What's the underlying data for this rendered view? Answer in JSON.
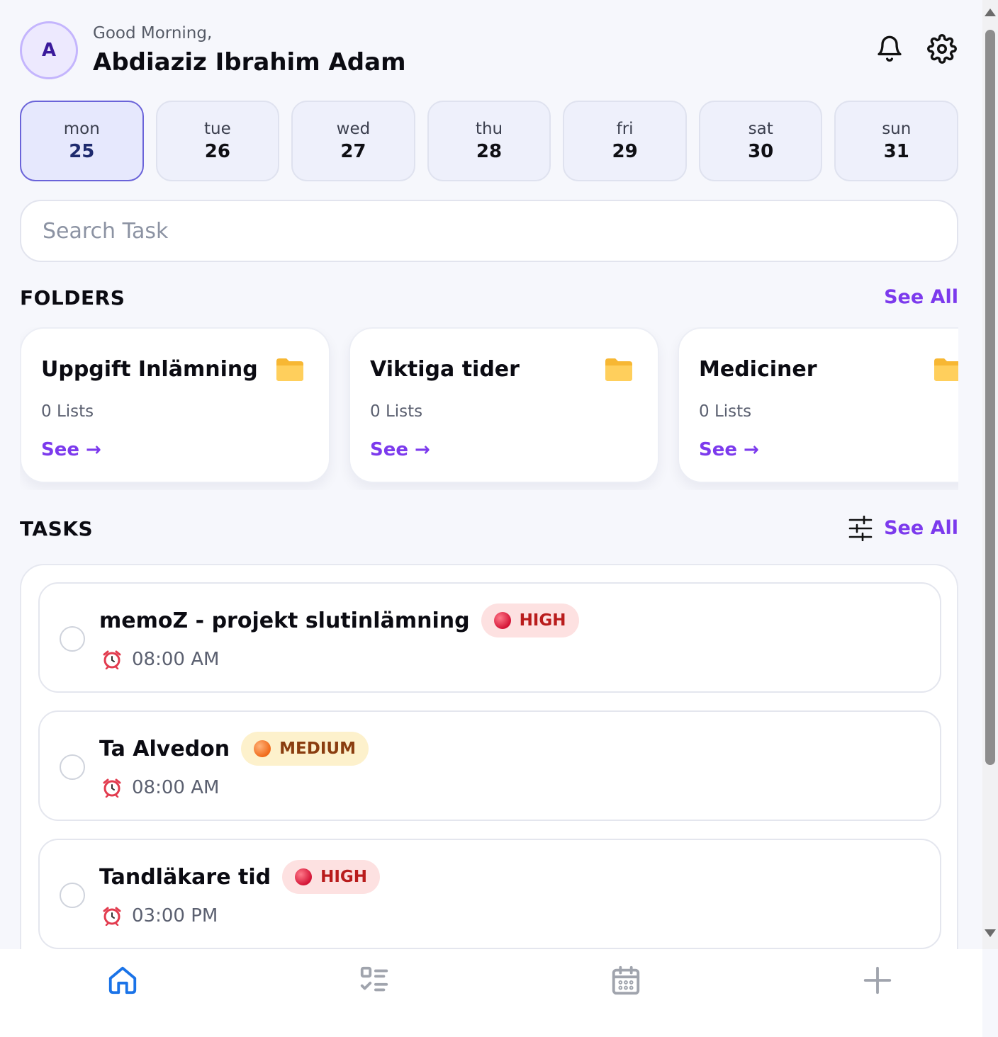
{
  "header": {
    "avatar_initial": "A",
    "greeting": "Good Morning,",
    "username": "Abdiaziz Ibrahim Adam",
    "icons": [
      "bell-icon",
      "gear-icon"
    ]
  },
  "days": [
    {
      "name": "mon",
      "num": "25",
      "active": true
    },
    {
      "name": "tue",
      "num": "26"
    },
    {
      "name": "wed",
      "num": "27"
    },
    {
      "name": "thu",
      "num": "28"
    },
    {
      "name": "fri",
      "num": "29"
    },
    {
      "name": "sat",
      "num": "30"
    },
    {
      "name": "sun",
      "num": "31"
    }
  ],
  "search": {
    "placeholder": "Search Task",
    "value": ""
  },
  "folders_section": {
    "title": "FOLDERS",
    "see_all": "See All",
    "items": [
      {
        "title": "Uppgift Inlämning",
        "count": "0 Lists",
        "link": "See →"
      },
      {
        "title": "Viktiga tider",
        "count": "0 Lists",
        "link": "See →"
      },
      {
        "title": "Mediciner",
        "count": "0 Lists",
        "link": "See →"
      }
    ]
  },
  "tasks_section": {
    "title": "TASKS",
    "see_all": "See All",
    "items": [
      {
        "title": "memoZ - projekt slutinlämning",
        "priority": "HIGH",
        "time": "08:00 AM"
      },
      {
        "title": "Ta Alvedon",
        "priority": "MEDIUM",
        "time": "08:00 AM"
      },
      {
        "title": "Tandläkare tid",
        "priority": "HIGH",
        "time": "03:00 PM"
      }
    ]
  },
  "bottom_nav": {
    "items": [
      "home-icon",
      "task-list-icon",
      "calendar-icon",
      "plus-icon"
    ],
    "active": "home-icon"
  },
  "colors": {
    "accent": "#7c3aed",
    "active_day_border": "#6a63d9",
    "high": "#b91c1c",
    "medium": "#8a3d0f",
    "nav_active": "#1a73e8"
  }
}
